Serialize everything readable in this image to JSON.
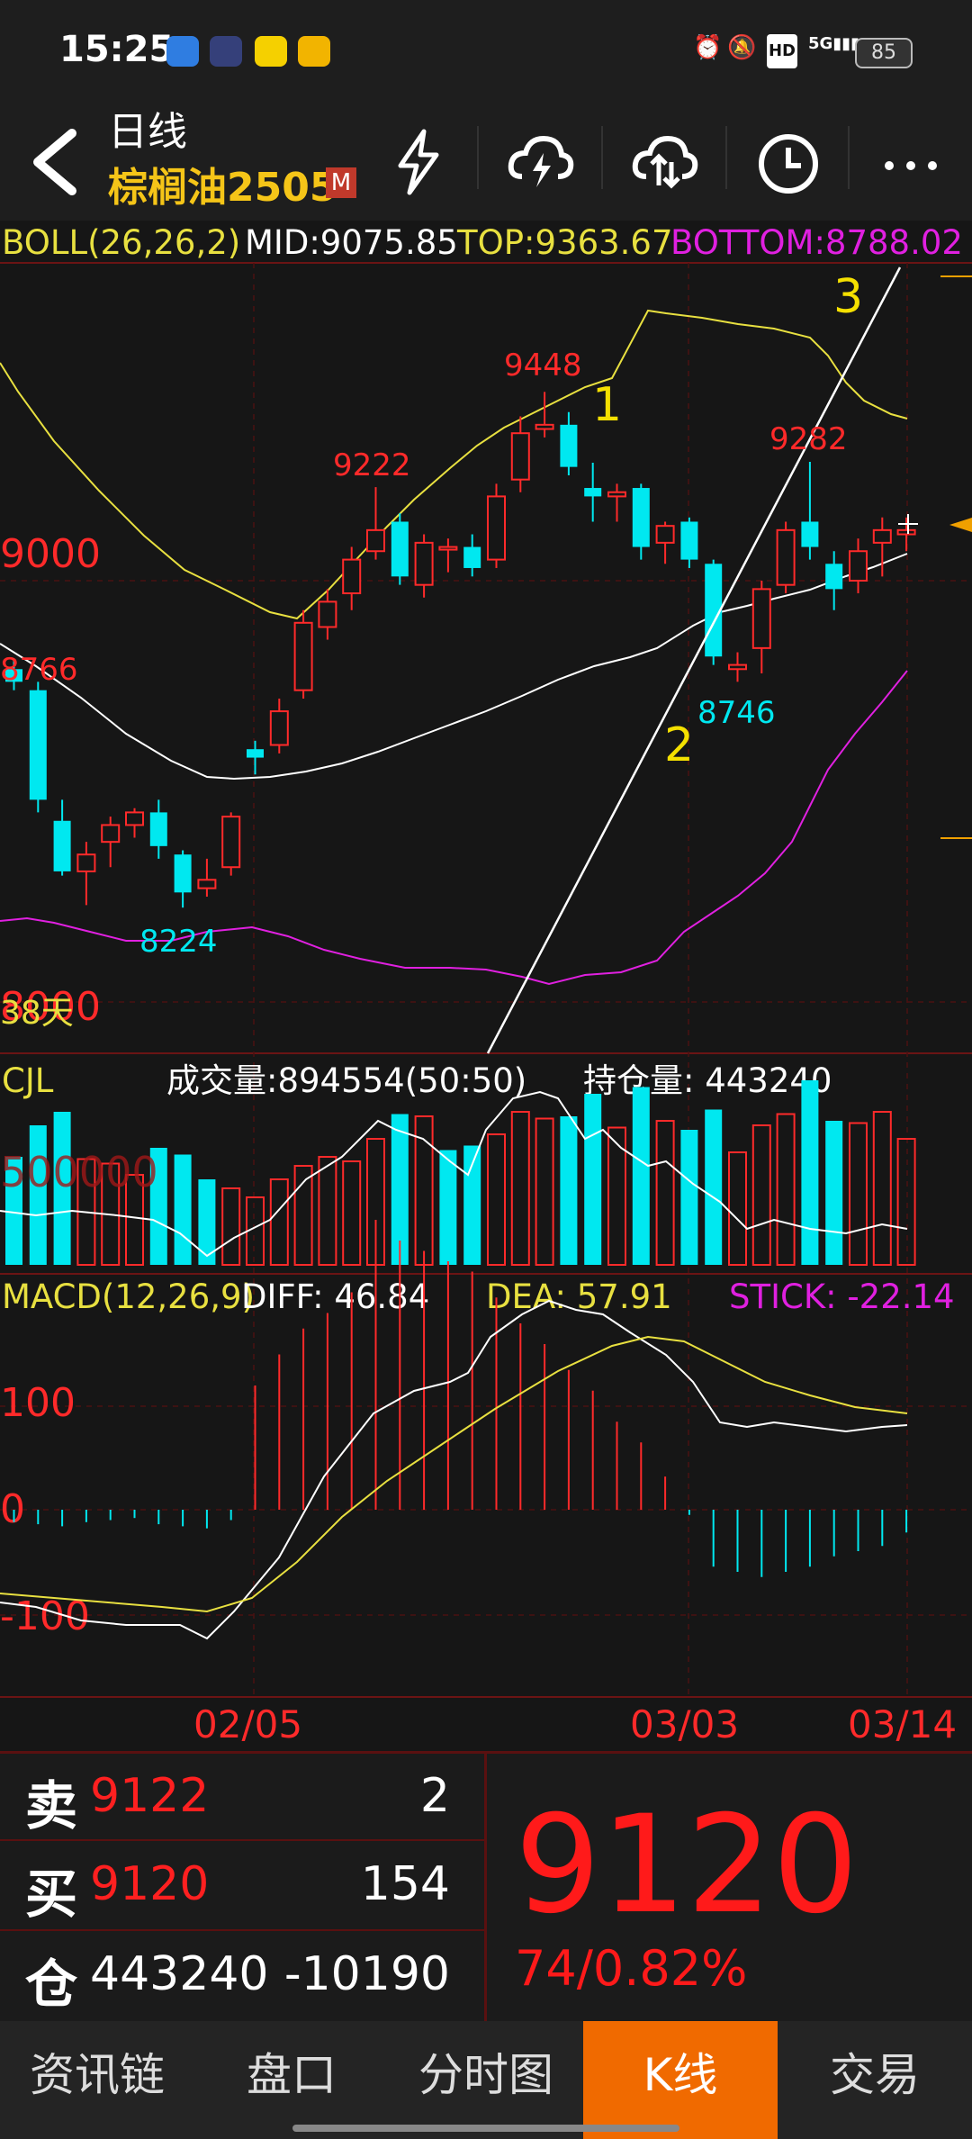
{
  "status_bar": {
    "time": "15:25",
    "battery": "85",
    "network": "5G",
    "icons": [
      "app-chart-icon",
      "app-play-icon",
      "app-green-icon",
      "weibo-icon",
      "alarm-icon",
      "mute-icon",
      "hd-icon",
      "signal-icon",
      "battery-icon"
    ]
  },
  "header": {
    "period": "日线",
    "contract": "棕榈油2505",
    "badge": "M",
    "icons": [
      "lightning-icon",
      "cloud-lightning-icon",
      "cloud-sync-icon",
      "clock-icon",
      "more-icon"
    ]
  },
  "boll": {
    "label": "BOLL(26,26,2)",
    "mid": "MID:9075.85",
    "top": "TOP:9363.67",
    "bottom": "BOTTOM:8788.02"
  },
  "price_axis": {
    "p9000": "9000",
    "p8000": "8000",
    "days": "38天"
  },
  "annotations": {
    "high1": "9448",
    "high2": "9222",
    "high3": "9282",
    "low1": "8224",
    "low2": "8746",
    "left": "8766",
    "wave1": "1",
    "wave2": "2",
    "wave3": "3"
  },
  "volume": {
    "label": "CJL",
    "volume_text": "成交量:894554(50:50)",
    "oi_text": "持仓量: 443240",
    "axis_ghost": "500000"
  },
  "macd": {
    "label": "MACD(12,26,9)",
    "diff": "DIFF: 46.84",
    "dea": "DEA: 57.91",
    "stick": "STICK: -22.14",
    "tick100": "100",
    "tick0": "0",
    "tickm100": "-100"
  },
  "dates": [
    "02/05",
    "03/03",
    "03/14"
  ],
  "chart_data": {
    "type": "candlestick",
    "candles": [
      {
        "o": 8790,
        "h": 8810,
        "l": 8740,
        "c": 8760
      },
      {
        "o": 8740,
        "h": 8760,
        "l": 8450,
        "c": 8480
      },
      {
        "o": 8430,
        "h": 8480,
        "l": 8300,
        "c": 8310
      },
      {
        "o": 8310,
        "h": 8380,
        "l": 8230,
        "c": 8350
      },
      {
        "o": 8380,
        "h": 8440,
        "l": 8320,
        "c": 8420
      },
      {
        "o": 8420,
        "h": 8460,
        "l": 8390,
        "c": 8450
      },
      {
        "o": 8450,
        "h": 8480,
        "l": 8340,
        "c": 8370
      },
      {
        "o": 8350,
        "h": 8360,
        "l": 8224,
        "c": 8260
      },
      {
        "o": 8270,
        "h": 8340,
        "l": 8250,
        "c": 8290
      },
      {
        "o": 8320,
        "h": 8450,
        "l": 8300,
        "c": 8440
      },
      {
        "o": 8600,
        "h": 8620,
        "l": 8540,
        "c": 8580
      },
      {
        "o": 8610,
        "h": 8720,
        "l": 8590,
        "c": 8690
      },
      {
        "o": 8740,
        "h": 8930,
        "l": 8720,
        "c": 8900
      },
      {
        "o": 8890,
        "h": 8980,
        "l": 8860,
        "c": 8950
      },
      {
        "o": 8970,
        "h": 9080,
        "l": 8930,
        "c": 9050
      },
      {
        "o": 9070,
        "h": 9222,
        "l": 9050,
        "c": 9120
      },
      {
        "o": 9140,
        "h": 9160,
        "l": 8990,
        "c": 9010
      },
      {
        "o": 8990,
        "h": 9110,
        "l": 8960,
        "c": 9090
      },
      {
        "o": 9080,
        "h": 9100,
        "l": 9020,
        "c": 9080
      },
      {
        "o": 9080,
        "h": 9110,
        "l": 9010,
        "c": 9030
      },
      {
        "o": 9050,
        "h": 9230,
        "l": 9030,
        "c": 9200
      },
      {
        "o": 9240,
        "h": 9390,
        "l": 9210,
        "c": 9350
      },
      {
        "o": 9360,
        "h": 9448,
        "l": 9340,
        "c": 9370
      },
      {
        "o": 9370,
        "h": 9400,
        "l": 9250,
        "c": 9270
      },
      {
        "o": 9220,
        "h": 9280,
        "l": 9140,
        "c": 9200
      },
      {
        "o": 9200,
        "h": 9230,
        "l": 9140,
        "c": 9210
      },
      {
        "o": 9220,
        "h": 9230,
        "l": 9050,
        "c": 9080
      },
      {
        "o": 9090,
        "h": 9140,
        "l": 9040,
        "c": 9130
      },
      {
        "o": 9140,
        "h": 9150,
        "l": 9030,
        "c": 9050
      },
      {
        "o": 9040,
        "h": 9050,
        "l": 8800,
        "c": 8820
      },
      {
        "o": 8790,
        "h": 8830,
        "l": 8760,
        "c": 8800
      },
      {
        "o": 8840,
        "h": 9000,
        "l": 8780,
        "c": 8980
      },
      {
        "o": 8990,
        "h": 9140,
        "l": 8970,
        "c": 9120
      },
      {
        "o": 9140,
        "h": 9282,
        "l": 9050,
        "c": 9080
      },
      {
        "o": 9040,
        "h": 9070,
        "l": 8930,
        "c": 8980
      },
      {
        "o": 9000,
        "h": 9100,
        "l": 8970,
        "c": 9070
      },
      {
        "o": 9090,
        "h": 9150,
        "l": 9010,
        "c": 9120
      },
      {
        "o": 9110,
        "h": 9150,
        "l": 9070,
        "c": 9120
      }
    ],
    "volume_bars": [
      {
        "v": 480000,
        "up": false
      },
      {
        "v": 620000,
        "up": false
      },
      {
        "v": 680000,
        "up": false
      },
      {
        "v": 470000,
        "up": true
      },
      {
        "v": 450000,
        "up": true
      },
      {
        "v": 400000,
        "up": true
      },
      {
        "v": 520000,
        "up": false
      },
      {
        "v": 490000,
        "up": false
      },
      {
        "v": 380000,
        "up": false
      },
      {
        "v": 340000,
        "up": true
      },
      {
        "v": 300000,
        "up": true
      },
      {
        "v": 380000,
        "up": true
      },
      {
        "v": 440000,
        "up": true
      },
      {
        "v": 480000,
        "up": true
      },
      {
        "v": 460000,
        "up": true
      },
      {
        "v": 560000,
        "up": true
      },
      {
        "v": 670000,
        "up": false
      },
      {
        "v": 660000,
        "up": true
      },
      {
        "v": 510000,
        "up": false
      },
      {
        "v": 530000,
        "up": false
      },
      {
        "v": 580000,
        "up": true
      },
      {
        "v": 680000,
        "up": true
      },
      {
        "v": 650000,
        "up": true
      },
      {
        "v": 660000,
        "up": false
      },
      {
        "v": 760000,
        "up": false
      },
      {
        "v": 610000,
        "up": true
      },
      {
        "v": 790000,
        "up": false
      },
      {
        "v": 640000,
        "up": true
      },
      {
        "v": 600000,
        "up": false
      },
      {
        "v": 690000,
        "up": false
      },
      {
        "v": 500000,
        "up": true
      },
      {
        "v": 620000,
        "up": true
      },
      {
        "v": 670000,
        "up": true
      },
      {
        "v": 820000,
        "up": false
      },
      {
        "v": 640000,
        "up": false
      },
      {
        "v": 630000,
        "up": true
      },
      {
        "v": 680000,
        "up": true
      },
      {
        "v": 560000,
        "up": true
      }
    ],
    "macd_stick": [
      -12,
      -14,
      -16,
      -12,
      -10,
      -8,
      -14,
      -16,
      -18,
      -10,
      120,
      150,
      175,
      190,
      210,
      280,
      260,
      250,
      240,
      230,
      205,
      180,
      160,
      135,
      115,
      85,
      65,
      32,
      -5,
      -55,
      -60,
      -65,
      -60,
      -55,
      -45,
      -40,
      -35,
      -22
    ],
    "ylim_price": [
      7900,
      9600
    ],
    "ylim_macd": [
      -200,
      300
    ],
    "xlabel": "",
    "ylabel": ""
  },
  "quote": {
    "sell_label": "卖",
    "sell_price": "9122",
    "sell_vol": "2",
    "buy_label": "买",
    "buy_price": "9120",
    "buy_vol": "154",
    "oi_label": "仓",
    "oi_value": "443240",
    "oi_change": "-10190",
    "last_price": "9120",
    "change": "74/0.82%"
  },
  "nav": {
    "tab1": "资讯链",
    "tab2": "盘口",
    "tab3": "分时图",
    "tab4": "K线",
    "tab5": "交易"
  },
  "colors": {
    "up": "#ff2a2a",
    "down": "#00e8f0",
    "boll_top": "#e8e040",
    "boll_bottom": "#e020e0",
    "mid": "#ffffff",
    "accent": "#f06a00"
  }
}
